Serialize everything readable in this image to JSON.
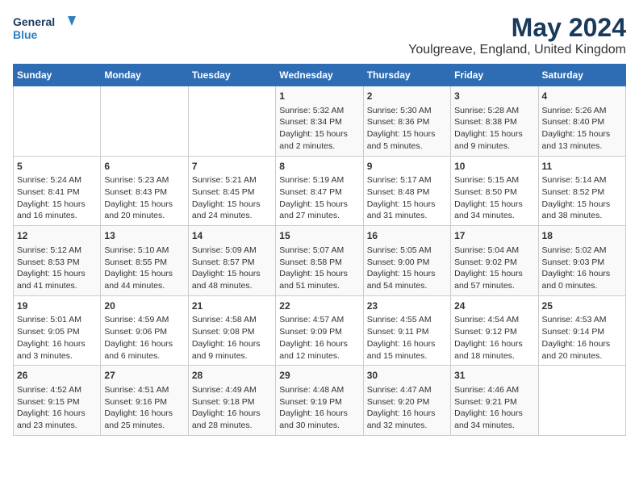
{
  "header": {
    "logo_line1": "General",
    "logo_line2": "Blue",
    "month_year": "May 2024",
    "location": "Youlgreave, England, United Kingdom"
  },
  "days_of_week": [
    "Sunday",
    "Monday",
    "Tuesday",
    "Wednesday",
    "Thursday",
    "Friday",
    "Saturday"
  ],
  "weeks": [
    [
      {
        "day": "",
        "info": ""
      },
      {
        "day": "",
        "info": ""
      },
      {
        "day": "",
        "info": ""
      },
      {
        "day": "1",
        "info": "Sunrise: 5:32 AM\nSunset: 8:34 PM\nDaylight: 15 hours\nand 2 minutes."
      },
      {
        "day": "2",
        "info": "Sunrise: 5:30 AM\nSunset: 8:36 PM\nDaylight: 15 hours\nand 5 minutes."
      },
      {
        "day": "3",
        "info": "Sunrise: 5:28 AM\nSunset: 8:38 PM\nDaylight: 15 hours\nand 9 minutes."
      },
      {
        "day": "4",
        "info": "Sunrise: 5:26 AM\nSunset: 8:40 PM\nDaylight: 15 hours\nand 13 minutes."
      }
    ],
    [
      {
        "day": "5",
        "info": "Sunrise: 5:24 AM\nSunset: 8:41 PM\nDaylight: 15 hours\nand 16 minutes."
      },
      {
        "day": "6",
        "info": "Sunrise: 5:23 AM\nSunset: 8:43 PM\nDaylight: 15 hours\nand 20 minutes."
      },
      {
        "day": "7",
        "info": "Sunrise: 5:21 AM\nSunset: 8:45 PM\nDaylight: 15 hours\nand 24 minutes."
      },
      {
        "day": "8",
        "info": "Sunrise: 5:19 AM\nSunset: 8:47 PM\nDaylight: 15 hours\nand 27 minutes."
      },
      {
        "day": "9",
        "info": "Sunrise: 5:17 AM\nSunset: 8:48 PM\nDaylight: 15 hours\nand 31 minutes."
      },
      {
        "day": "10",
        "info": "Sunrise: 5:15 AM\nSunset: 8:50 PM\nDaylight: 15 hours\nand 34 minutes."
      },
      {
        "day": "11",
        "info": "Sunrise: 5:14 AM\nSunset: 8:52 PM\nDaylight: 15 hours\nand 38 minutes."
      }
    ],
    [
      {
        "day": "12",
        "info": "Sunrise: 5:12 AM\nSunset: 8:53 PM\nDaylight: 15 hours\nand 41 minutes."
      },
      {
        "day": "13",
        "info": "Sunrise: 5:10 AM\nSunset: 8:55 PM\nDaylight: 15 hours\nand 44 minutes."
      },
      {
        "day": "14",
        "info": "Sunrise: 5:09 AM\nSunset: 8:57 PM\nDaylight: 15 hours\nand 48 minutes."
      },
      {
        "day": "15",
        "info": "Sunrise: 5:07 AM\nSunset: 8:58 PM\nDaylight: 15 hours\nand 51 minutes."
      },
      {
        "day": "16",
        "info": "Sunrise: 5:05 AM\nSunset: 9:00 PM\nDaylight: 15 hours\nand 54 minutes."
      },
      {
        "day": "17",
        "info": "Sunrise: 5:04 AM\nSunset: 9:02 PM\nDaylight: 15 hours\nand 57 minutes."
      },
      {
        "day": "18",
        "info": "Sunrise: 5:02 AM\nSunset: 9:03 PM\nDaylight: 16 hours\nand 0 minutes."
      }
    ],
    [
      {
        "day": "19",
        "info": "Sunrise: 5:01 AM\nSunset: 9:05 PM\nDaylight: 16 hours\nand 3 minutes."
      },
      {
        "day": "20",
        "info": "Sunrise: 4:59 AM\nSunset: 9:06 PM\nDaylight: 16 hours\nand 6 minutes."
      },
      {
        "day": "21",
        "info": "Sunrise: 4:58 AM\nSunset: 9:08 PM\nDaylight: 16 hours\nand 9 minutes."
      },
      {
        "day": "22",
        "info": "Sunrise: 4:57 AM\nSunset: 9:09 PM\nDaylight: 16 hours\nand 12 minutes."
      },
      {
        "day": "23",
        "info": "Sunrise: 4:55 AM\nSunset: 9:11 PM\nDaylight: 16 hours\nand 15 minutes."
      },
      {
        "day": "24",
        "info": "Sunrise: 4:54 AM\nSunset: 9:12 PM\nDaylight: 16 hours\nand 18 minutes."
      },
      {
        "day": "25",
        "info": "Sunrise: 4:53 AM\nSunset: 9:14 PM\nDaylight: 16 hours\nand 20 minutes."
      }
    ],
    [
      {
        "day": "26",
        "info": "Sunrise: 4:52 AM\nSunset: 9:15 PM\nDaylight: 16 hours\nand 23 minutes."
      },
      {
        "day": "27",
        "info": "Sunrise: 4:51 AM\nSunset: 9:16 PM\nDaylight: 16 hours\nand 25 minutes."
      },
      {
        "day": "28",
        "info": "Sunrise: 4:49 AM\nSunset: 9:18 PM\nDaylight: 16 hours\nand 28 minutes."
      },
      {
        "day": "29",
        "info": "Sunrise: 4:48 AM\nSunset: 9:19 PM\nDaylight: 16 hours\nand 30 minutes."
      },
      {
        "day": "30",
        "info": "Sunrise: 4:47 AM\nSunset: 9:20 PM\nDaylight: 16 hours\nand 32 minutes."
      },
      {
        "day": "31",
        "info": "Sunrise: 4:46 AM\nSunset: 9:21 PM\nDaylight: 16 hours\nand 34 minutes."
      },
      {
        "day": "",
        "info": ""
      }
    ]
  ]
}
